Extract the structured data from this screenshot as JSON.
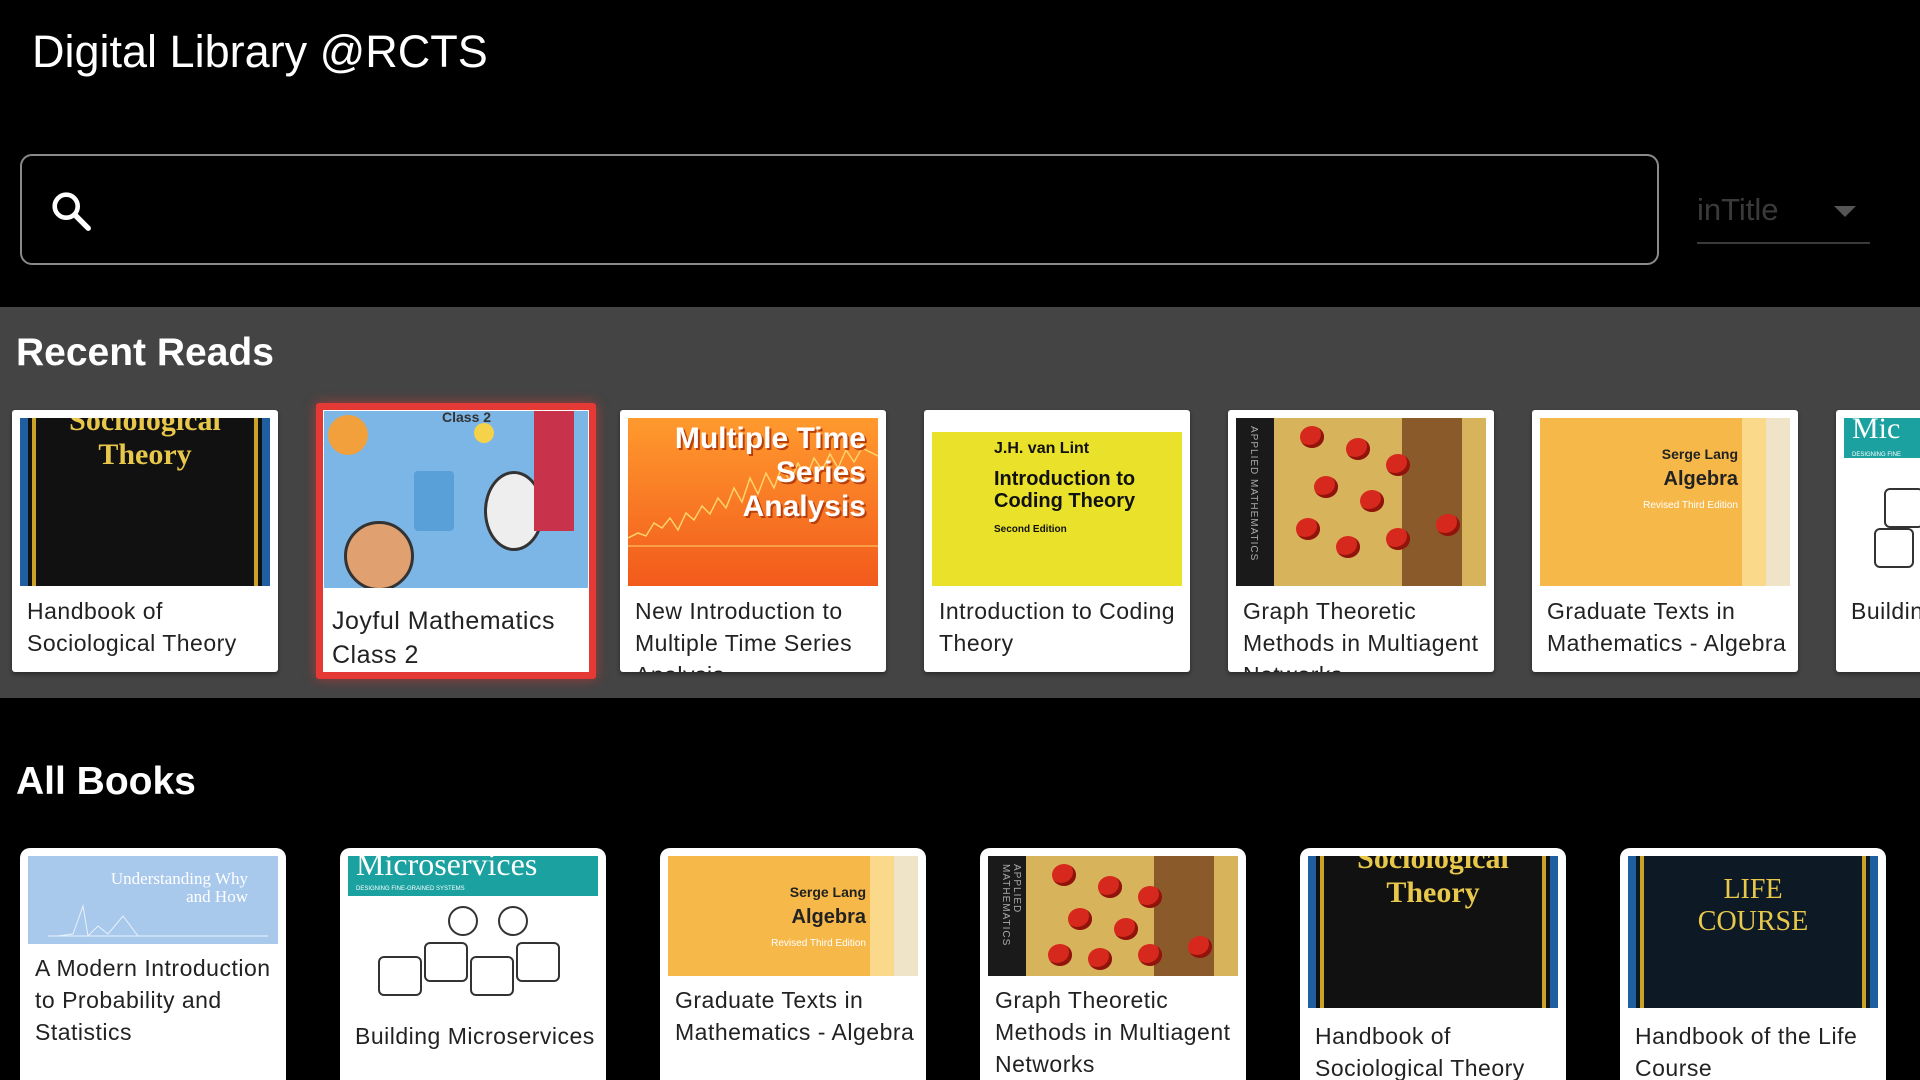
{
  "app": {
    "title": "Digital Library @RCTS"
  },
  "search": {
    "value": "",
    "placeholder": "",
    "filter_value": "inTitle"
  },
  "recent": {
    "heading": "Recent Reads",
    "items": [
      {
        "title": "Handbook of Sociological Theory",
        "cover": "sociological",
        "cover_text": [
          "Sociological",
          "Theory"
        ]
      },
      {
        "title": "Joyful Mathematics Class 2",
        "cover": "joyful",
        "cover_text": [
          "Class 2"
        ],
        "selected": true
      },
      {
        "title": "New Introduction to Multiple Time Series Analysis",
        "cover": "mts",
        "cover_text": [
          "Multiple Time",
          "Series",
          "Analysis"
        ]
      },
      {
        "title": "Introduction to Coding Theory",
        "cover": "coding",
        "cover_text": [
          "J.H. van Lint",
          "Introduction to",
          "Coding Theory",
          "Second Edition"
        ]
      },
      {
        "title": "Graph Theoretic Methods in Multiagent Networks",
        "cover": "graph",
        "cover_text": [
          "APPLIED MATHEMATICS"
        ]
      },
      {
        "title": "Graduate Texts in Mathematics - Algebra",
        "cover": "algebra",
        "cover_text": [
          "Serge Lang",
          "Algebra",
          "Revised Third Edition"
        ]
      },
      {
        "title": "Building Microservices",
        "cover": "micro",
        "cover_text": [
          "Mic",
          "DESIGNING FINE"
        ]
      }
    ]
  },
  "all_books": {
    "heading": "All Books",
    "items": [
      {
        "title": "A Modern Introduction to Probability and Statistics",
        "cover": "prob",
        "cover_text": [
          "Understanding Why",
          "and How"
        ]
      },
      {
        "title": "Building Microservices",
        "cover": "micro",
        "cover_text": [
          "Microservices",
          "DESIGNING FINE-GRAINED SYSTEMS"
        ]
      },
      {
        "title": "Graduate Texts in Mathematics - Algebra",
        "cover": "algebra",
        "cover_text": [
          "Serge Lang",
          "Algebra",
          "Revised Third Edition"
        ]
      },
      {
        "title": "Graph Theoretic Methods in Multiagent Networks",
        "cover": "graph",
        "cover_text": [
          "APPLIED MATHEMATICS"
        ]
      },
      {
        "title": "Handbook of Sociological Theory",
        "cover": "sociological",
        "cover_text": [
          "Sociological",
          "Theory"
        ]
      },
      {
        "title": "Handbook of the Life Course",
        "cover": "life",
        "cover_text": [
          "LIFE",
          "COURSE"
        ]
      }
    ]
  },
  "colors": {
    "accent_selected": "#e53935",
    "recent_bg": "#444444",
    "page_bg": "#000000"
  },
  "icons": {
    "search": "search-icon",
    "dropdown": "chevron-down-icon"
  }
}
